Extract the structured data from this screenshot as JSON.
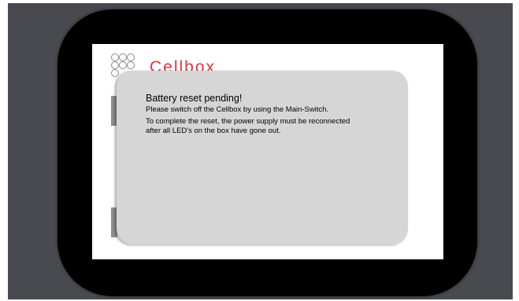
{
  "app": {
    "brand": "Cellbox"
  },
  "dialog": {
    "title": "Battery reset pending!",
    "lines": [
      "Please switch off the Cellbox by using the Main-Switch.",
      "To complete the reset, the power supply must be reconnected",
      "after all LED's on the box have gone out."
    ]
  },
  "colors": {
    "brand_red": "#d9363e",
    "dialog_bg": "#d6d6d6",
    "bezel": "#000000",
    "backdrop": "#484a4f"
  }
}
